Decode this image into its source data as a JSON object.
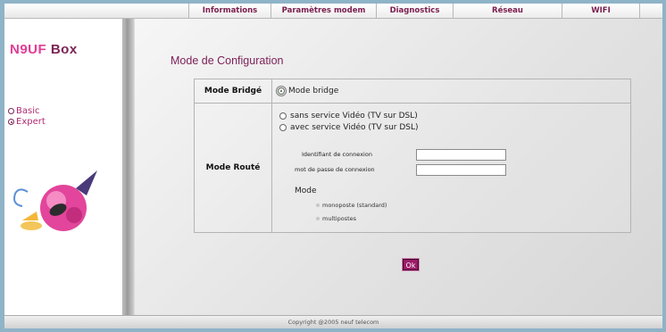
{
  "nav": {
    "tabs": [
      {
        "label": "Informations"
      },
      {
        "label": "Paramètres modem"
      },
      {
        "label": "Diagnostics"
      },
      {
        "label": "Réseau"
      },
      {
        "label": "WIFI"
      }
    ]
  },
  "sidebar": {
    "logo_prefix": "N9UF",
    "logo_suffix": "Box",
    "mode_basic": "Basic",
    "mode_expert": "Expert",
    "selected_mode": "Expert"
  },
  "main": {
    "title": "Mode de Configuration",
    "bridge_label": "Mode Bridgé",
    "bridge_option": "Mode bridge",
    "routed_label": "Mode Routé",
    "routed_options": [
      {
        "label": "sans service Vidéo (TV sur DSL)"
      },
      {
        "label": "avec service Vidéo (TV sur DSL)"
      }
    ],
    "login_label": "Identifiant de connexion",
    "login_value": "",
    "password_label": "mot de passe de connexion",
    "password_value": "",
    "mode_heading": "Mode",
    "mode_options": [
      {
        "label": "monoposte (standard)"
      },
      {
        "label": "multipostes"
      }
    ],
    "ok_label": "Ok"
  },
  "footer": {
    "copyright": "Copyright @2005 neuf telecom"
  },
  "colors": {
    "brand": "#7a2454",
    "accent": "#e23c96",
    "button": "#9b1a68"
  }
}
